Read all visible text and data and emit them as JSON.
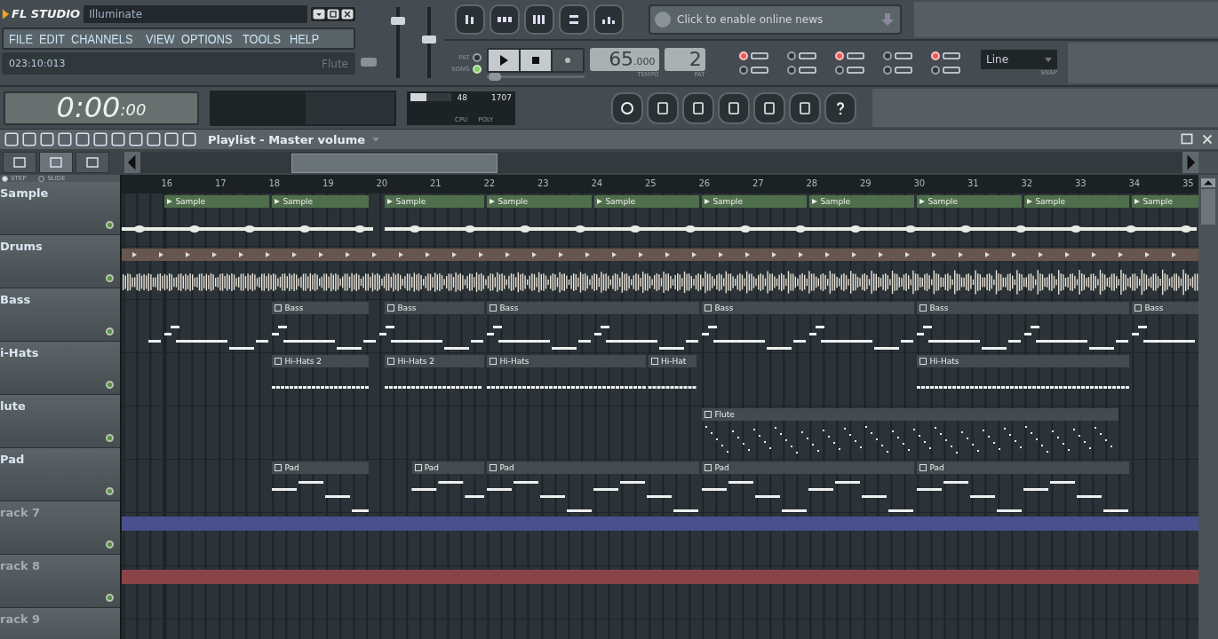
{
  "app": {
    "logo": "FL STUDIO",
    "project": "Illuminate"
  },
  "menu": [
    "FILE",
    "EDIT",
    "CHANNELS",
    "VIEW",
    "OPTIONS",
    "TOOLS",
    "HELP"
  ],
  "hint_bar": {
    "position": "023:10:013",
    "channel": "Flute"
  },
  "master_volume": {
    "level": 0.85
  },
  "master_pitch": {
    "level": 0.55
  },
  "news": {
    "text": "Click to enable online news"
  },
  "transport": {
    "modes": [
      {
        "label": "PAT",
        "selected": false
      },
      {
        "label": "SONG",
        "selected": true
      }
    ],
    "tempo": "65",
    "tempo_fraction": ".000",
    "tempo_label": "TEMPO",
    "pattern": "2",
    "pattern_label": "PAT",
    "song_position": {
      "level": 0.02
    }
  },
  "record_toggles": [
    {
      "on": true
    },
    {
      "on": false
    },
    {
      "on": true
    },
    {
      "on": false
    },
    {
      "on": true
    },
    {
      "on": false
    },
    {
      "on": false
    },
    {
      "on": false
    },
    {
      "on": false
    },
    {
      "on": false
    }
  ],
  "snap": {
    "value": "Line",
    "label": "SNAP"
  },
  "time_display": {
    "time": "0:00",
    "ticks": ":00"
  },
  "cpu_panel": {
    "cpu_meter": {
      "level": 0.4
    },
    "memory": "48",
    "poly": "1707",
    "cpu_label": "CPU",
    "poly_label": "POLY"
  },
  "playlist": {
    "title": "Playlist - Master volume",
    "view_tabs": [
      {
        "selected": false
      },
      {
        "selected": true
      },
      {
        "selected": false
      }
    ],
    "modes": [
      {
        "label": "STEP",
        "selected": true
      },
      {
        "label": "SLIDE",
        "selected": false
      }
    ],
    "ruler": [
      "16",
      "17",
      "18",
      "19",
      "20",
      "21",
      "22",
      "23",
      "24",
      "25",
      "26",
      "27",
      "28",
      "29",
      "30",
      "31",
      "32",
      "33",
      "34",
      "35"
    ],
    "tracks": [
      {
        "name": "Sample",
        "kind": "audio",
        "clips": [
          "Sample",
          "Sample",
          "Sample",
          "Sample",
          "Sample",
          "Sample",
          "Sample",
          "Sample",
          "Sample",
          "Sample"
        ]
      },
      {
        "name": "Drums",
        "kind": "drums"
      },
      {
        "name": "Bass",
        "kind": "bass",
        "clips": [
          "Bass",
          "Bass",
          "Bass",
          "Bass",
          "Bass",
          "Bass"
        ]
      },
      {
        "name": "i-Hats",
        "kind": "hats",
        "clips": [
          "Hi-Hats 2",
          "Hi-Hats 2",
          "Hi-Hats",
          "Hi-Hat",
          "Hi-Hats"
        ]
      },
      {
        "name": "lute",
        "kind": "dots",
        "clips": [
          "Flute"
        ]
      },
      {
        "name": "Pad",
        "kind": "pad",
        "clips": [
          "Pad",
          "Pad",
          "Pad",
          "Pad",
          "Pad"
        ]
      },
      {
        "name": "rack 7",
        "kind": "automation",
        "color": "#4a4f8e"
      },
      {
        "name": "rack 8",
        "kind": "automation",
        "color": "#8a4448"
      },
      {
        "name": "rack 9",
        "kind": "empty"
      }
    ]
  }
}
